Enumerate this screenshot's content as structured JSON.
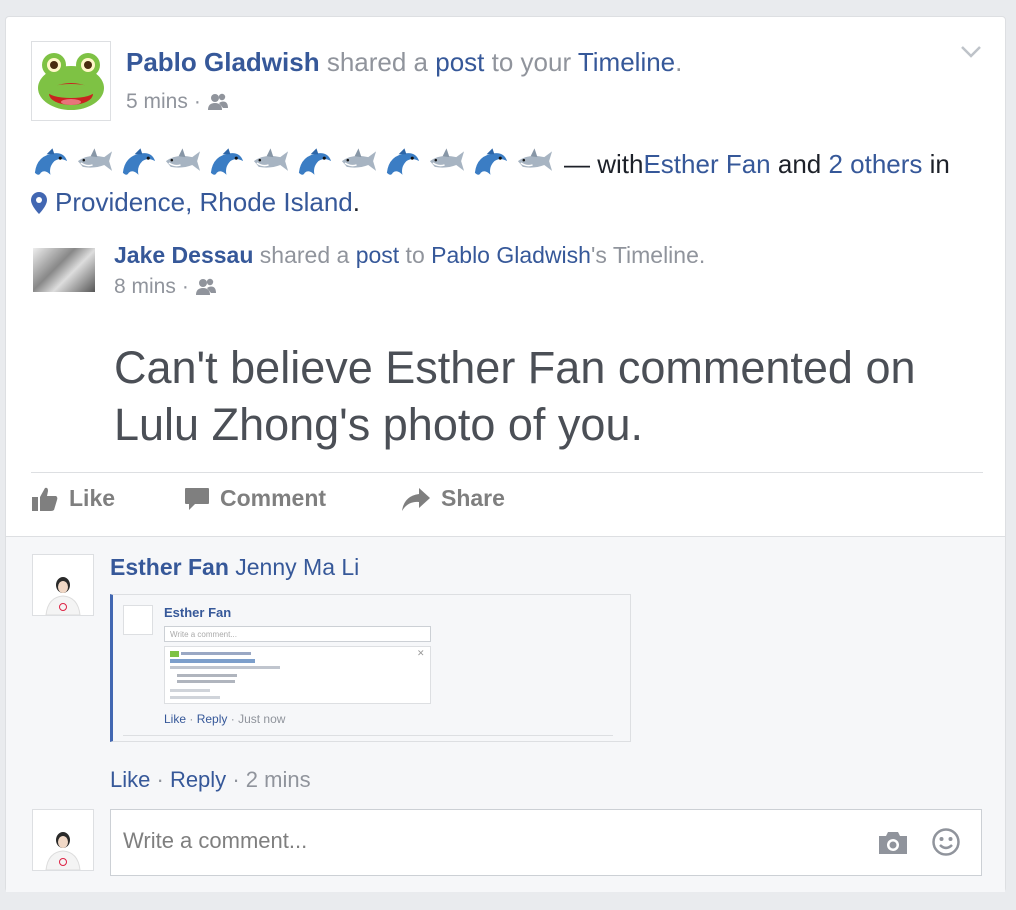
{
  "post": {
    "author": "Pablo Gladwish",
    "shared_text": " shared a ",
    "post_link": "post",
    "to_text": " to your ",
    "timeline_link": "Timeline",
    "period": ".",
    "time": "5 mins",
    "dot": "·",
    "privacy_icon": "friends-icon",
    "with_text": "— with ",
    "with_person": "Esther Fan",
    "and_text": " and ",
    "others": "2 others",
    "in_text": " in",
    "location": "Providence, Rhode Island",
    "location_period": ".",
    "emoji_count_dolphin": 6,
    "emoji_count_shark": 6
  },
  "shared": {
    "author": "Jake Dessau",
    "shared_text": " shared a ",
    "post_link": "post",
    "to_text": " to ",
    "target": "Pablo Gladwish",
    "target_suffix": "'s Timeline.",
    "time": "8 mins",
    "dot": "·",
    "message": "Can't believe Esther Fan commented on Lulu Zhong's photo of you."
  },
  "actions": {
    "like": "Like",
    "comment": "Comment",
    "share": "Share"
  },
  "comment": {
    "author": "Esther Fan",
    "tag": "Jenny Ma Li",
    "like": "Like",
    "dot": "·",
    "reply": "Reply",
    "time": "2 mins",
    "screenshot": {
      "name": "Esther Fan",
      "placeholder": "Write a comment...",
      "like": "Like",
      "reply": "Reply",
      "time": "Just now",
      "dot": "·"
    }
  },
  "composer": {
    "placeholder": "Write a comment..."
  },
  "colors": {
    "link": "#365899",
    "muted": "#90949c"
  }
}
